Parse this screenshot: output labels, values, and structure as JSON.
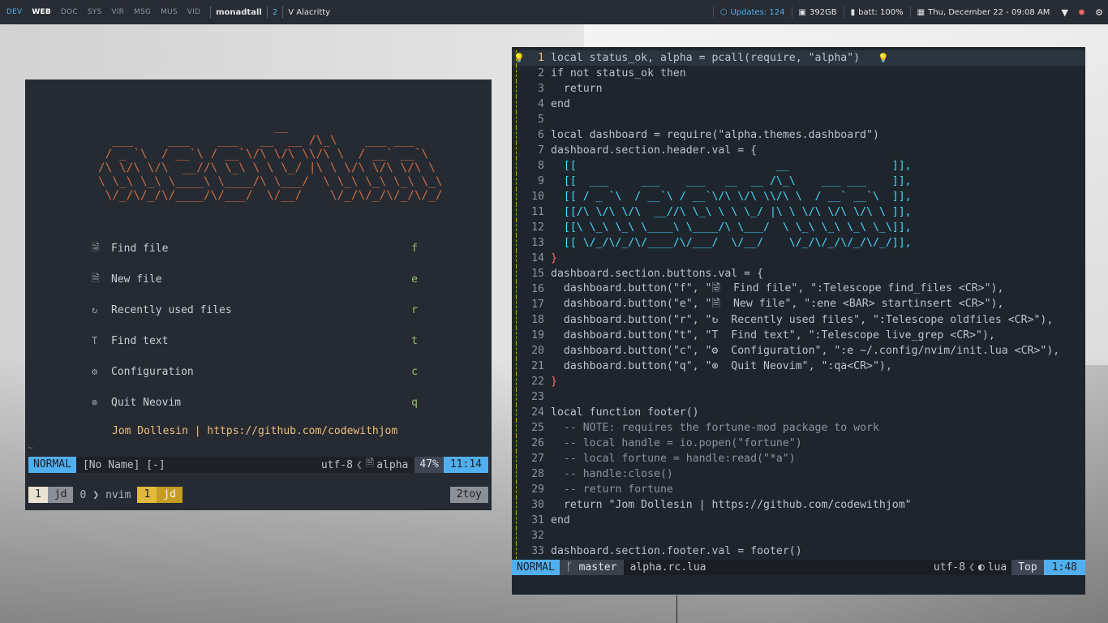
{
  "topbar": {
    "workspaces": [
      "DEV",
      "WEB",
      "DOC",
      "SYS",
      "VIR",
      "MSG",
      "MUS",
      "VID"
    ],
    "active_workspace": "WEB",
    "layout": "monadtall",
    "window_count": "2",
    "window_title": "V Alacritty",
    "updates": "Updates: 124",
    "disk": "392GB",
    "battery": "batt: 100%",
    "datetime": "Thu, December 22 - 09:08 AM"
  },
  "left_nvim": {
    "ascii_art": "                         __\n  ___     ___    ___   __  __ /\\_\\    ___ ___\n / _ `\\  / __`\\ / __`\\/\\ \\/\\ \\\\/\\ \\  / __` __`\\\n/\\ \\/\\ \\/\\  __//\\ \\_\\ \\ \\ \\_/ |\\ \\ \\/\\ \\/\\ \\/\\ \\\n\\ \\_\\ \\_\\ \\____\\ \\____/\\ \\___/  \\ \\_\\ \\_\\ \\_\\ \\_\\\n \\/_/\\/_/\\/____/\\/___/  \\/__/    \\/_/\\/_/\\/_/\\/_/",
    "menu": [
      {
        "icon": "🗟",
        "label": "Find file",
        "key": "f"
      },
      {
        "icon": "🗎",
        "label": "New file",
        "key": "e"
      },
      {
        "icon": "↻",
        "label": "Recently used files",
        "key": "r"
      },
      {
        "icon": "T",
        "label": "Find text",
        "key": "t"
      },
      {
        "icon": "⚙",
        "label": "Configuration",
        "key": "c"
      },
      {
        "icon": "⊗",
        "label": "Quit Neovim",
        "key": "q"
      }
    ],
    "footer": "Jom Dollesin | https://github.com/codewithjom",
    "tilde": "~",
    "statusline": {
      "mode": "NORMAL",
      "buffer": "[No Name] [-]",
      "encoding": "utf-8",
      "filetype": "alpha",
      "percent": "47%",
      "position": "11:14"
    },
    "tmux": {
      "window1_index": "1",
      "window1_name": "jd",
      "window2_index": "0",
      "window2_name": "nvim",
      "window3_index": "1",
      "window3_name": "jd",
      "session": "2toy"
    }
  },
  "right_nvim": {
    "code_lines": [
      "local status_ok, alpha = pcall(require, \"alpha\")",
      "if not status_ok then",
      "  return",
      "end",
      "",
      "local dashboard = require(\"alpha.themes.dashboard\")",
      "dashboard.section.header.val = {",
      "  [[                               __                ]],",
      "  [[  ___     ___    ___   __  __ /\\_\\    ___ ___    ]],",
      "  [[ / _ `\\  / __`\\ / __`\\/\\ \\/\\ \\\\/\\ \\  / __` __`\\  ]],",
      "  [[/\\ \\/\\ \\/\\  __//\\ \\_\\ \\ \\ \\_/ |\\ \\ \\/\\ \\/\\ \\/\\ \\ ]],",
      "  [[\\ \\_\\ \\_\\ \\____\\ \\____/\\ \\___/  \\ \\_\\ \\_\\ \\_\\ \\_\\]],",
      "  [[ \\/_/\\/_/\\/____/\\/___/  \\/__/    \\/_/\\/_/\\/_/\\/_/]],",
      "}",
      "dashboard.section.buttons.val = {",
      "  dashboard.button(\"f\", \"🗟  Find file\", \":Telescope find_files <CR>\"),",
      "  dashboard.button(\"e\", \"🗎  New file\", \":ene <BAR> startinsert <CR>\"),",
      "  dashboard.button(\"r\", \"↻  Recently used files\", \":Telescope oldfiles <CR>\"),",
      "  dashboard.button(\"t\", \"T  Find text\", \":Telescope live_grep <CR>\"),",
      "  dashboard.button(\"c\", \"⚙  Configuration\", \":e ~/.config/nvim/init.lua <CR>\"),",
      "  dashboard.button(\"q\", \"⊗  Quit Neovim\", \":qa<CR>\"),",
      "}",
      "",
      "local function footer()",
      "  -- NOTE: requires the fortune-mod package to work",
      "  -- local handle = io.popen(\"fortune\")",
      "  -- local fortune = handle:read(\"*a\")",
      "  -- handle:close()",
      "  -- return fortune",
      "  return \"Jom Dollesin | https://github.com/codewithjom\"",
      "end",
      "",
      "dashboard.section.footer.val = footer()"
    ],
    "statusline": {
      "mode": "NORMAL",
      "branch": "master",
      "filename": "alpha.rc.lua",
      "encoding": "utf-8",
      "filetype": "lua",
      "scroll": "Top",
      "position": "1:48"
    }
  }
}
